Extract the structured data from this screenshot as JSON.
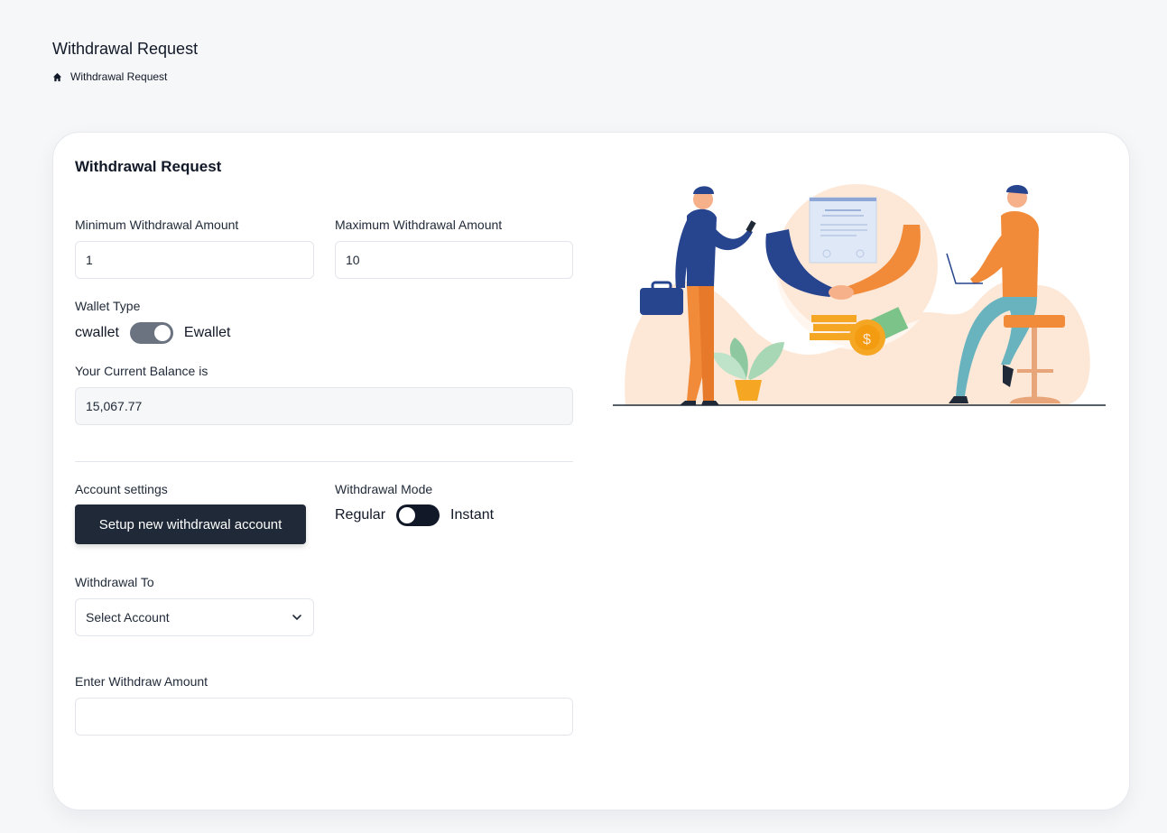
{
  "header": {
    "title": "Withdrawal Request",
    "breadcrumb": {
      "home_icon": "home-icon",
      "current": "Withdrawal Request"
    }
  },
  "card": {
    "title": "Withdrawal Request",
    "min_amount": {
      "label": "Minimum Withdrawal Amount",
      "value": "1"
    },
    "max_amount": {
      "label": "Maximum Withdrawal Amount",
      "value": "10"
    },
    "wallet_type": {
      "label": "Wallet Type",
      "left_option": "cwallet",
      "right_option": "Ewallet",
      "state": "Ewallet"
    },
    "balance": {
      "label": "Your Current Balance is",
      "value": "15,067.77"
    },
    "account_settings": {
      "label": "Account settings",
      "button_label": "Setup new withdrawal account"
    },
    "withdrawal_mode": {
      "label": "Withdrawal Mode",
      "left_option": "Regular",
      "right_option": "Instant",
      "state": "Regular"
    },
    "withdrawal_to": {
      "label": "Withdrawal To",
      "selected": "Select Account",
      "icon": "chevron-down-icon"
    },
    "withdraw_amount": {
      "label": "Enter Withdraw Amount",
      "value": "",
      "placeholder": ""
    }
  },
  "colors": {
    "accent_dark": "#1f2937",
    "toggle_on": "#6b7280",
    "illustration_orange": "#f18b3a",
    "illustration_blue": "#27448f",
    "illustration_peach": "#fde8d7"
  }
}
